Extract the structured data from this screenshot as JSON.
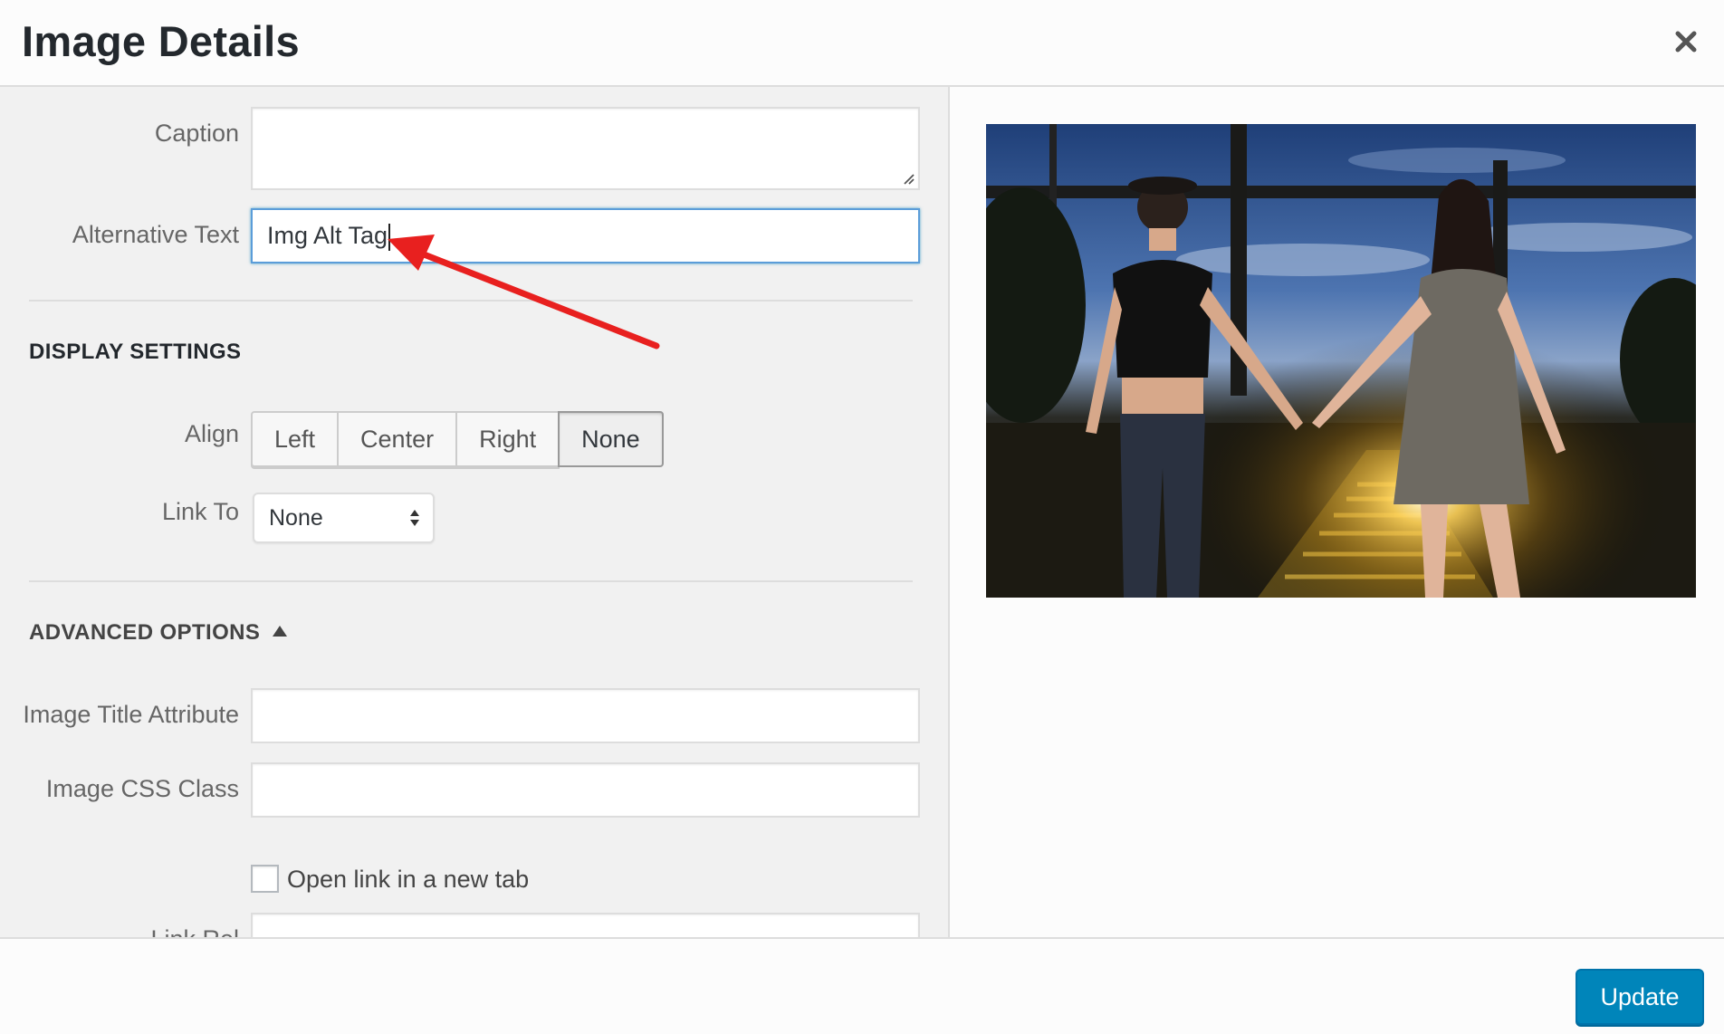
{
  "modal": {
    "title": "Image Details",
    "close_icon": "close-icon"
  },
  "fields": {
    "caption_label": "Caption",
    "caption_value": "",
    "alt_label": "Alternative Text",
    "alt_value": "Img Alt Tag"
  },
  "display_settings": {
    "title": "DISPLAY SETTINGS",
    "align_label": "Align",
    "align_options": [
      "Left",
      "Center",
      "Right",
      "None"
    ],
    "align_selected": "None",
    "link_label": "Link To",
    "link_value": "None"
  },
  "advanced": {
    "title": "ADVANCED OPTIONS",
    "title_attr_label": "Image Title Attribute",
    "title_attr_value": "",
    "css_class_label": "Image CSS Class",
    "css_class_value": "",
    "new_tab_label": "Open link in a new tab",
    "new_tab_checked": false,
    "link_rel_label": "Link Rel"
  },
  "footer": {
    "update_label": "Update"
  },
  "colors": {
    "primary_button": "#0085ba",
    "focus_border": "#5b9dd9",
    "annotation_arrow": "#e8201f"
  }
}
